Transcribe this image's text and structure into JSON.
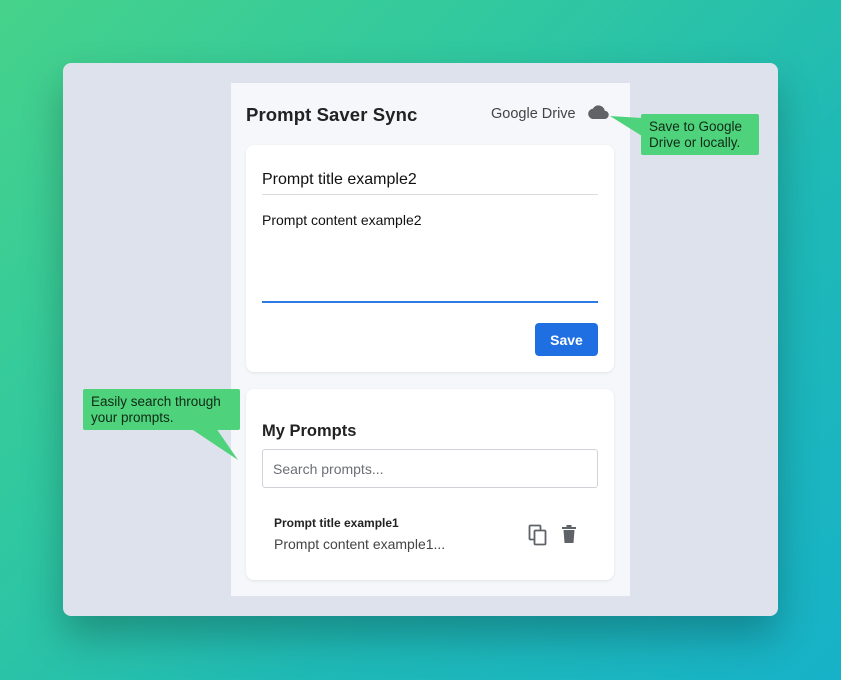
{
  "app": {
    "title": "Prompt Saver Sync",
    "storage_label": "Google Drive"
  },
  "editor": {
    "title_value": "Prompt title example2",
    "content_value": "Prompt content example2",
    "save_label": "Save"
  },
  "prompts": {
    "heading": "My Prompts",
    "search_placeholder": "Search prompts...",
    "items": [
      {
        "title": "Prompt title example1",
        "content": "Prompt content example1..."
      }
    ]
  },
  "callouts": {
    "drive": "Save to Google Drive or locally.",
    "search": "Easily search through your prompts."
  },
  "icons": {
    "storage": "cloud-icon",
    "copy": "copy-icon",
    "delete": "trash-icon"
  },
  "colors": {
    "accent": "#1f6fe3",
    "callout": "#4ed27b",
    "focus_underline": "#2f7ae5"
  }
}
